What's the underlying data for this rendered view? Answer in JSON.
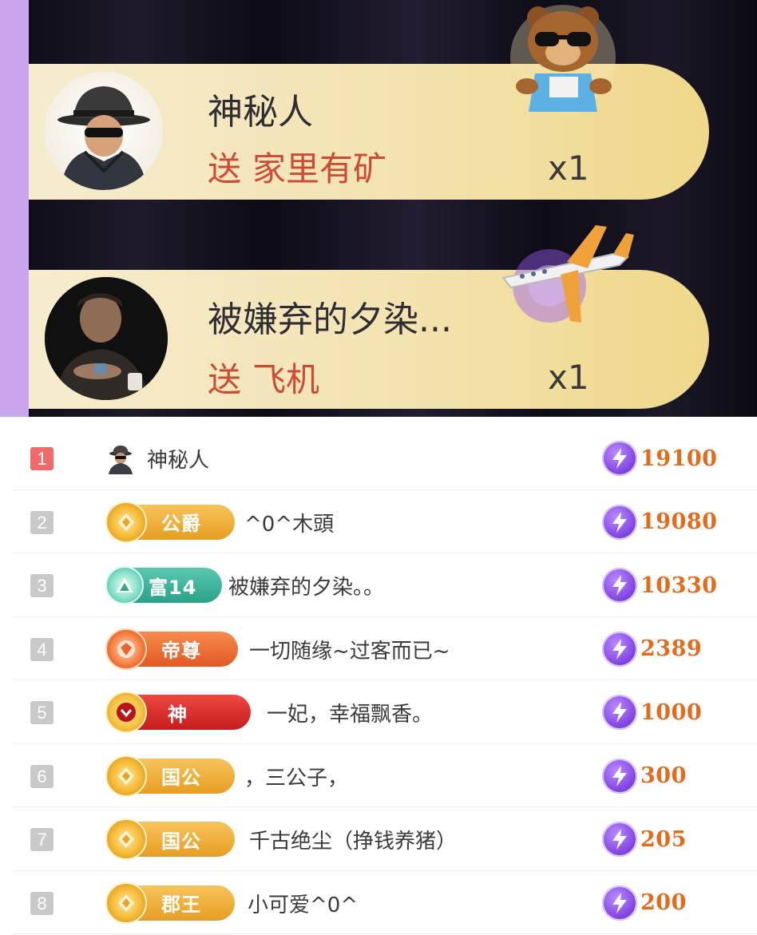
{
  "gift_feed": [
    {
      "user": "神秘人",
      "verb": "送",
      "gift": "家里有矿",
      "count": "x1"
    },
    {
      "user": "被嫌弃的夕染...",
      "verb": "送",
      "gift": "飞机",
      "count": "x1"
    }
  ],
  "ranking": [
    {
      "rank": "1",
      "badge": "",
      "name": "神秘人",
      "score": "19100"
    },
    {
      "rank": "2",
      "badge": "公爵",
      "name": "^0^木頭",
      "score": "19080"
    },
    {
      "rank": "3",
      "badge": "富14",
      "name": "被嫌弃的夕染。。",
      "score": "10330"
    },
    {
      "rank": "4",
      "badge": "帝尊",
      "name": "一切随缘~过客而已~",
      "score": "2389"
    },
    {
      "rank": "5",
      "badge": "神",
      "name": "一妃，幸福飘香。",
      "score": "1000"
    },
    {
      "rank": "6",
      "badge": "国公",
      "name": "，三公子，",
      "score": "300"
    },
    {
      "rank": "7",
      "badge": "国公",
      "name": "千古绝尘（挣钱养猪）",
      "score": "205"
    },
    {
      "rank": "8",
      "badge": "郡王",
      "name": "小可爱^0^",
      "score": "200"
    }
  ],
  "colors": {
    "accent_bar": "#c9a6ee",
    "gift_text": "#cf4a35",
    "score_text": "#e46a1c",
    "rank1_bg": "#ef6b6b",
    "rank_bg": "#c9c9c9"
  },
  "icons": {
    "anon": "mysterious-person-icon",
    "currency": "lightning-coin-icon",
    "gift1": "bear-sunglasses-gift-icon",
    "gift2": "airplane-gift-icon"
  }
}
